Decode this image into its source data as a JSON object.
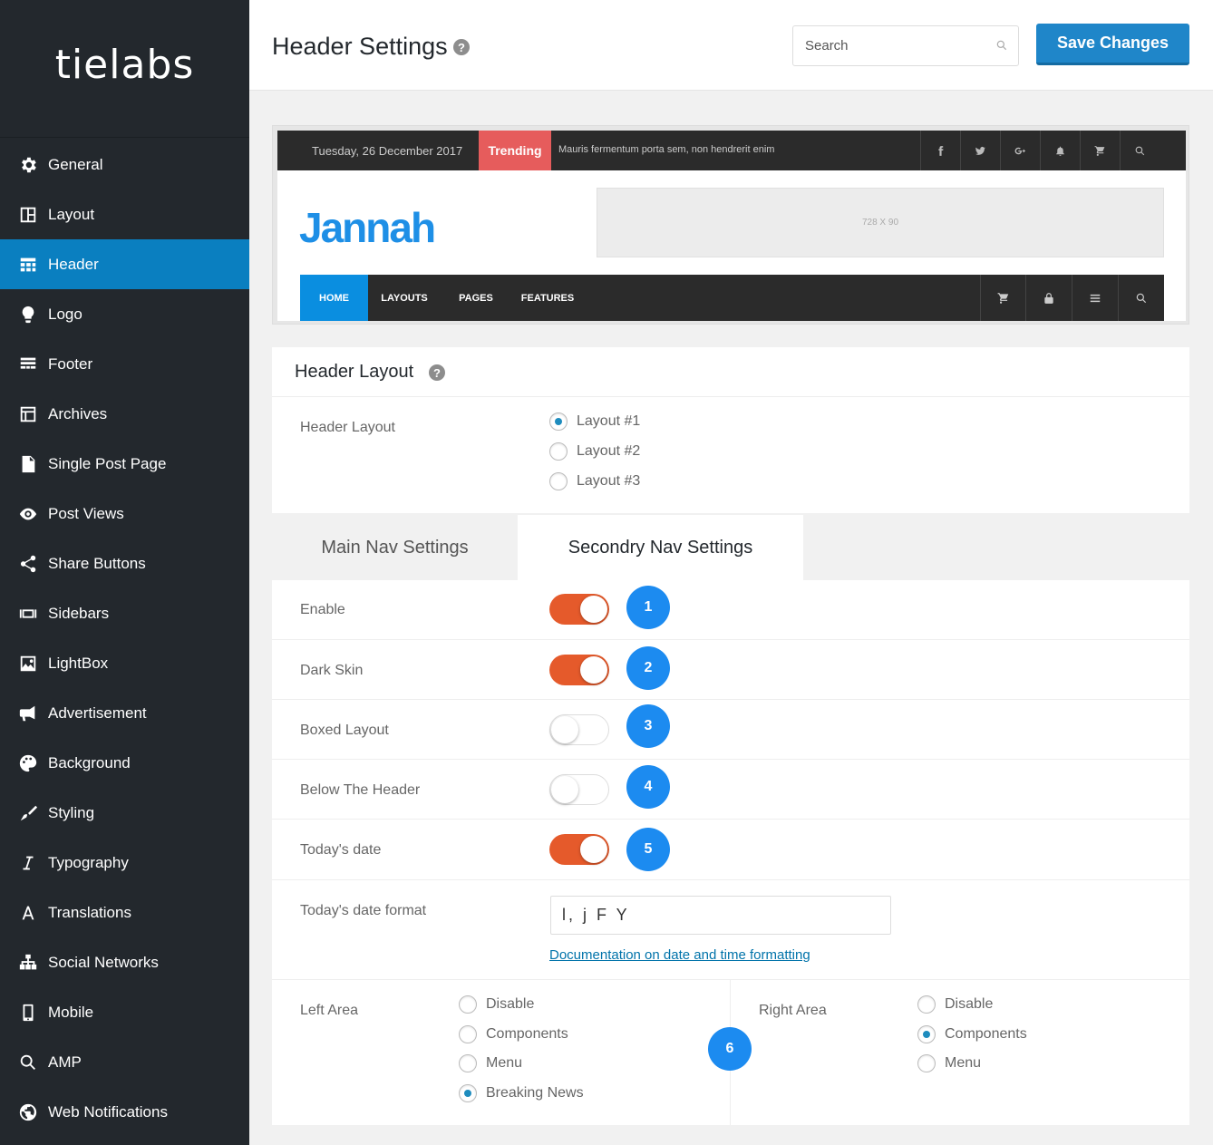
{
  "sidebar": {
    "logo_text": "tielabs",
    "items": [
      {
        "label": "General",
        "icon": "gear-icon"
      },
      {
        "label": "Layout",
        "icon": "layout-icon"
      },
      {
        "label": "Header",
        "icon": "header-grid-icon",
        "active": true
      },
      {
        "label": "Logo",
        "icon": "lightbulb-icon"
      },
      {
        "label": "Footer",
        "icon": "footer-icon"
      },
      {
        "label": "Archives",
        "icon": "archives-icon"
      },
      {
        "label": "Single Post Page",
        "icon": "document-icon"
      },
      {
        "label": "Post Views",
        "icon": "eye-icon"
      },
      {
        "label": "Share Buttons",
        "icon": "share-icon"
      },
      {
        "label": "Sidebars",
        "icon": "sidebars-icon"
      },
      {
        "label": "LightBox",
        "icon": "image-icon"
      },
      {
        "label": "Advertisement",
        "icon": "megaphone-icon"
      },
      {
        "label": "Background",
        "icon": "palette-icon"
      },
      {
        "label": "Styling",
        "icon": "brush-icon"
      },
      {
        "label": "Typography",
        "icon": "italic-icon"
      },
      {
        "label": "Translations",
        "icon": "letter-a-icon"
      },
      {
        "label": "Social Networks",
        "icon": "sitemap-icon"
      },
      {
        "label": "Mobile",
        "icon": "mobile-icon"
      },
      {
        "label": "AMP",
        "icon": "search-icon"
      },
      {
        "label": "Web Notifications",
        "icon": "globe-icon"
      }
    ]
  },
  "header": {
    "title": "Header Settings",
    "help": "?",
    "search_placeholder": "Search",
    "save_label": "Save Changes"
  },
  "preview": {
    "date": "Tuesday, 26 December 2017",
    "trending": "Trending",
    "ticker": "Mauris fermentum porta sem, non hendrerit enim",
    "brand": "Jannah",
    "ad_size": "728 X 90",
    "menu": [
      "HOME",
      "LAYOUTS",
      "PAGES",
      "FEATURES"
    ],
    "social_icons": [
      "facebook-icon",
      "twitter-icon",
      "google-plus-icon",
      "bell-icon",
      "cart-icon",
      "search-icon"
    ],
    "nav_icons": [
      "cart-icon",
      "lock-icon",
      "menu-icon",
      "search-icon"
    ]
  },
  "layout_section": {
    "title": "Header Layout",
    "label": "Header Layout",
    "options": [
      "Layout #1",
      "Layout #2",
      "Layout #3"
    ],
    "selected": 0
  },
  "tabs": {
    "main": "Main Nav Settings",
    "secondary": "Secondry Nav Settings",
    "active": "secondary"
  },
  "settings": {
    "rows": [
      {
        "label": "Enable",
        "on": true,
        "badge": "1"
      },
      {
        "label": "Dark Skin",
        "on": true,
        "badge": "2"
      },
      {
        "label": "Boxed Layout",
        "on": false,
        "badge": "3"
      },
      {
        "label": "Below The Header",
        "on": false,
        "badge": "4"
      },
      {
        "label": "Today's date",
        "on": true,
        "badge": "5"
      }
    ],
    "date_format_label": "Today's date format",
    "date_format_value": "l, j F Y",
    "doc_link": "Documentation on date and time formatting",
    "left_area": {
      "label": "Left Area",
      "options": [
        "Disable",
        "Components",
        "Menu",
        "Breaking News"
      ],
      "selected": 3
    },
    "right_area": {
      "label": "Right Area",
      "options": [
        "Disable",
        "Components",
        "Menu"
      ],
      "selected": 1
    },
    "area_badge": "6"
  },
  "colors": {
    "sidebar_bg": "#23282d",
    "active_item": "#0a7fc0",
    "save_button": "#1f86c9",
    "switch_on": "#e55a2b",
    "badge": "#1c8bf0",
    "trending": "#e65c5c",
    "brand": "#1e8fe6"
  }
}
